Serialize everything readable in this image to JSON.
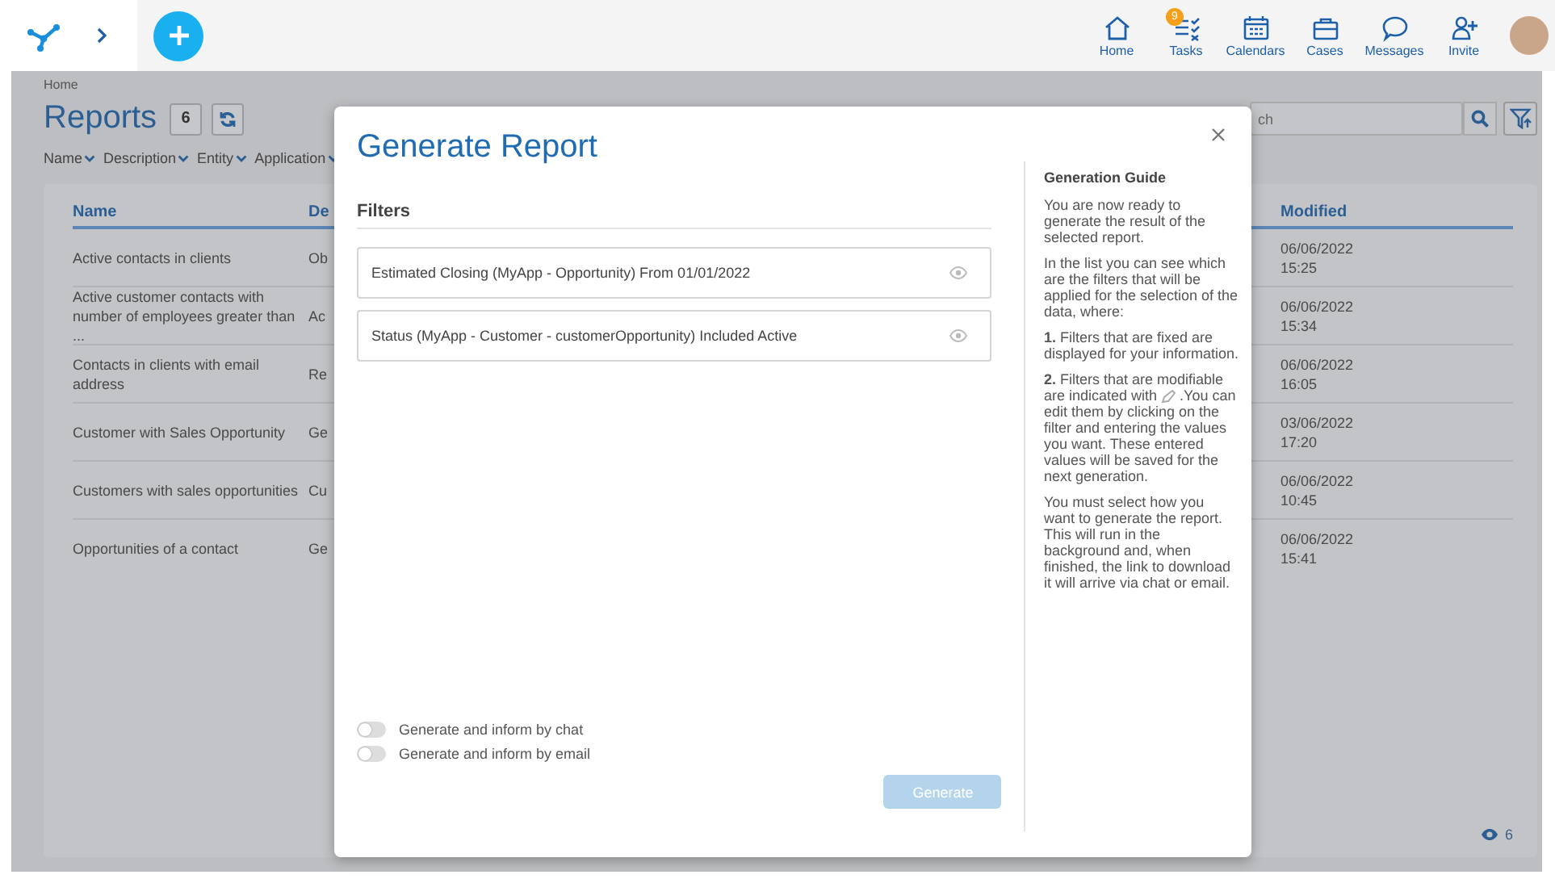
{
  "header": {
    "nav_items": [
      {
        "label": "Home"
      },
      {
        "label": "Tasks",
        "badge": "9"
      },
      {
        "label": "Calendars"
      },
      {
        "label": "Cases"
      },
      {
        "label": "Messages"
      },
      {
        "label": "Invite"
      }
    ]
  },
  "breadcrumb": "Home",
  "page_title": "Reports",
  "report_count": "6",
  "sort_fields": [
    "Name",
    "Description",
    "Entity",
    "Application"
  ],
  "search": {
    "placeholder": "ch"
  },
  "table": {
    "columns": [
      "Name",
      "De",
      "Modified"
    ],
    "rows": [
      {
        "name": "Active contacts in clients",
        "description": "Ob",
        "modified_date": "06/06/2022",
        "modified_time": "15:25"
      },
      {
        "name": "Active customer contacts with number of employees greater than ...",
        "description": "Ac",
        "modified_date": "06/06/2022",
        "modified_time": "15:34"
      },
      {
        "name": "Contacts in clients with email address",
        "description": "Re",
        "modified_date": "06/06/2022",
        "modified_time": "16:05"
      },
      {
        "name": "Customer with Sales Opportunity",
        "description": "Ge",
        "modified_date": "03/06/2022",
        "modified_time": "17:20"
      },
      {
        "name": "Customers with sales opportunities",
        "description": "Cu",
        "modified_date": "06/06/2022",
        "modified_time": "10:45"
      },
      {
        "name": "Opportunities of a contact",
        "description": "Ge",
        "modified_date": "06/06/2022",
        "modified_time": "15:41"
      }
    ],
    "footer_count": "6"
  },
  "dialog": {
    "title": "Generate Report",
    "filters_heading": "Filters",
    "filters": [
      {
        "text": "Estimated Closing (MyApp - Opportunity) From 01/01/2022"
      },
      {
        "text": "Status (MyApp - Customer - customerOpportunity) Included Active"
      }
    ],
    "options": [
      {
        "label": "Generate and inform by chat",
        "on": false
      },
      {
        "label": "Generate and inform by email",
        "on": false
      }
    ],
    "button": {
      "label": "Generate",
      "disabled": true
    },
    "guide": {
      "heading": "Generation Guide",
      "paragraphs": [
        {
          "text": "You are now ready to generate the result of the selected report."
        },
        {
          "text": "In the list you can see which are the filters that will be applied for the selection of the data, where:"
        },
        {
          "text": "**1.** Filters that are fixed are displayed for your information."
        },
        {
          "text": "**2.** Filters that are modifiable are indicated with",
          "after_icon": ".You can edit them by clicking on the filter and entering the values you want. These entered values will be saved for the next generation."
        },
        {
          "text": "You must select how you want to generate the report. This will run in the background and, when finished, the link to download it will arrive via chat or email."
        }
      ]
    }
  }
}
